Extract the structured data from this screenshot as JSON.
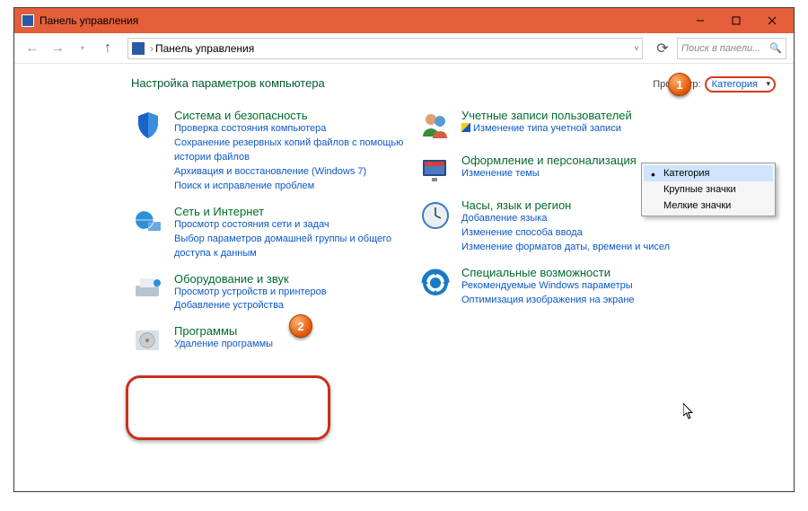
{
  "titlebar": {
    "title": "Панель управления"
  },
  "addressbar": {
    "text": "Панель управления"
  },
  "search": {
    "placeholder": "Поиск в панели..."
  },
  "header": {
    "title": "Настройка параметров компьютера",
    "view_label": "Просмотр:",
    "view_value": "Категория"
  },
  "dropdown": {
    "options": [
      "Категория",
      "Крупные значки",
      "Мелкие значки"
    ],
    "selected": 0
  },
  "markers": {
    "m1": "1",
    "m2": "2"
  },
  "left": [
    {
      "title": "Система и безопасность",
      "links": [
        "Проверка состояния компьютера",
        "Сохранение резервных копий файлов с помощью истории файлов",
        "Архивация и восстановление (Windows 7)",
        "Поиск и исправление проблем"
      ]
    },
    {
      "title": "Сеть и Интернет",
      "links": [
        "Просмотр состояния сети и задач",
        "Выбор параметров домашней группы и общего доступа к данным"
      ]
    },
    {
      "title": "Оборудование и звук",
      "links": [
        "Просмотр устройств и принтеров",
        "Добавление устройства"
      ]
    },
    {
      "title": "Программы",
      "links": [
        "Удаление программы"
      ]
    }
  ],
  "right": [
    {
      "title": "Учетные записи пользователей",
      "links": [
        "Изменение типа учетной записи"
      ],
      "shield": true
    },
    {
      "title": "Оформление и персонализация",
      "links": [
        "Изменение темы"
      ]
    },
    {
      "title": "Часы, язык и регион",
      "links": [
        "Добавление языка",
        "Изменение способа ввода",
        "Изменение форматов даты, времени и чисел"
      ]
    },
    {
      "title": "Специальные возможности",
      "links": [
        "Рекомендуемые Windows параметры",
        "Оптимизация изображения на экране"
      ]
    }
  ]
}
